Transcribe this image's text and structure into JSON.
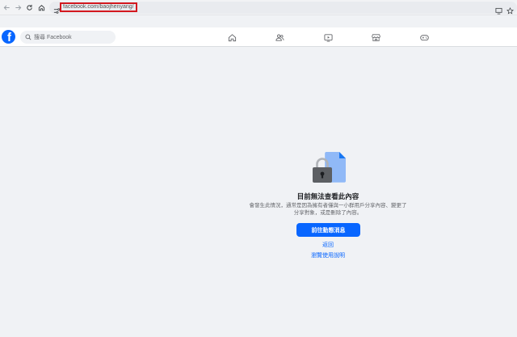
{
  "browser": {
    "url": "facebook.com/baojhenyang/",
    "icons": [
      "back-icon",
      "forward-icon",
      "reload-icon",
      "home-icon",
      "site-info-icon",
      "cast-icon",
      "bookmark-star-icon"
    ]
  },
  "header": {
    "logo": "f",
    "search_placeholder": "搜尋 Facebook",
    "nav_tabs": [
      "home-icon",
      "friends-icon",
      "video-icon",
      "marketplace-icon",
      "gaming-icon"
    ]
  },
  "content": {
    "title": "目前無法查看此內容",
    "description": "會發生此情況，通常是因為擁有者僅與一小群用戶分享內容、變更了分享對象，或是刪除了內容。",
    "primary_button": "前往動態消息",
    "back_link": "返回",
    "help_link": "瀏覽使用說明"
  },
  "colors": {
    "brand": "#0866ff",
    "page_bg": "#f0f2f5",
    "highlight_border": "#d4181f"
  }
}
